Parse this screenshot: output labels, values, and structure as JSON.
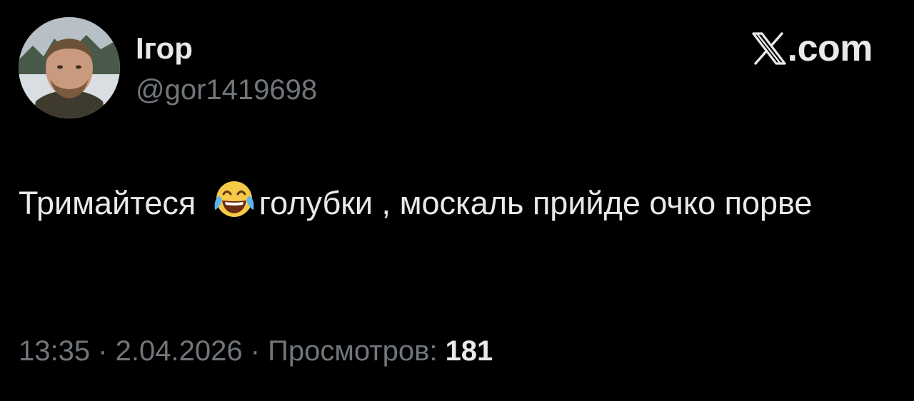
{
  "author": {
    "display_name": "Ігор",
    "handle": "@gor1419698",
    "avatar": "avatar-photo"
  },
  "brand": {
    "icon": "x-logo-icon",
    "domain": ".com"
  },
  "tweet": {
    "text_part1": "Тримайтеся ",
    "emoji": "face-with-tears-of-joy-icon",
    "text_part2": "голубки , москаль прийде очко порве"
  },
  "meta": {
    "time": "13:35",
    "separator1": " · ",
    "date": "2.04.2026",
    "separator2": " · ",
    "views_label": "Просмотров: ",
    "views_count": "181"
  },
  "colors": {
    "background": "#000000",
    "primary_text": "#e7e9ea",
    "secondary_text": "#71767b"
  }
}
